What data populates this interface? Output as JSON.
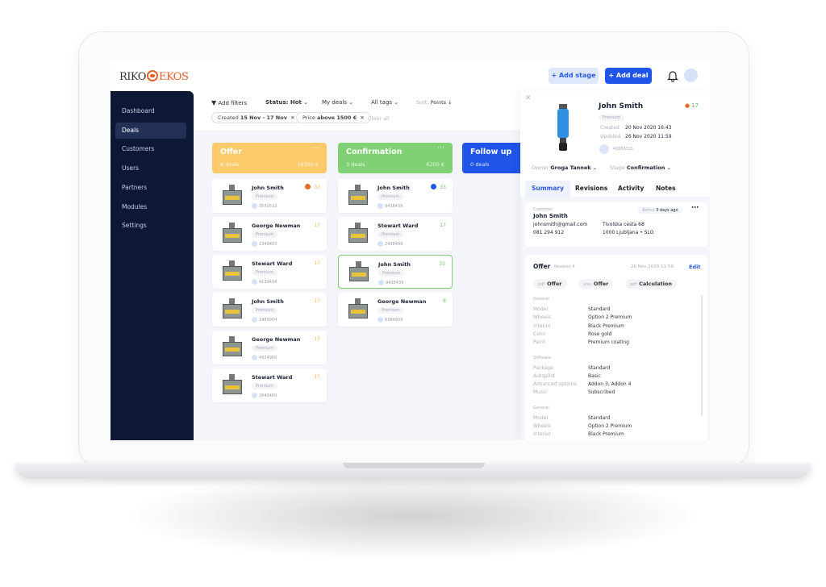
{
  "brand": {
    "logo_left": "RIKO",
    "logo_right": "EKOS"
  },
  "header": {
    "add_stage": "+ Add stage",
    "add_deal": "+ Add deal",
    "icons": [
      "bell-icon",
      "avatar"
    ]
  },
  "sidebar": {
    "items": [
      {
        "label": "Dashboard"
      },
      {
        "label": "Deals",
        "active": true
      },
      {
        "label": "Customers"
      },
      {
        "label": "Users"
      },
      {
        "label": "Partners"
      },
      {
        "label": "Modules"
      },
      {
        "label": "Settings"
      }
    ]
  },
  "filters": {
    "add_filters": "Add filters",
    "status": "Status: Hot",
    "my_deals": "My deals",
    "all_tags": "All tags",
    "sort_label": "Sort:",
    "sort_value": "Points ↓",
    "chips": [
      {
        "prefix": "Created",
        "value": "15 Nov - 17 Nov"
      },
      {
        "prefix": "Price",
        "value": "above 1500 €"
      }
    ],
    "clear_all": "Clear all"
  },
  "columns": [
    {
      "title": "Offer",
      "count": "6 deals",
      "total": "18300 €",
      "color": "#fbcb6b",
      "score_color": "#f5b94a",
      "cards": [
        {
          "name": "John Smith",
          "tag": "Premium",
          "id": "3532532",
          "score": "33",
          "badge": "fire"
        },
        {
          "name": "George Newman",
          "tag": "Premium",
          "id": "1349483",
          "score": "17"
        },
        {
          "name": "Stewart Ward",
          "tag": "Premium",
          "id": "4139434",
          "score": "17"
        },
        {
          "name": "John Smith",
          "tag": "Premium",
          "id": "3483904",
          "score": "17"
        },
        {
          "name": "George Newman",
          "tag": "Premium",
          "id": "4924900",
          "score": "17"
        },
        {
          "name": "Stewart Ward",
          "tag": "Premium",
          "id": "2849400",
          "score": "17"
        }
      ]
    },
    {
      "title": "Confirmation",
      "count": "3 deals",
      "total": "6200 €",
      "color": "#7fd174",
      "score_color": "#6cc263",
      "cards": [
        {
          "name": "John Smith",
          "tag": "Premium",
          "id": "9438439",
          "score": "33",
          "badge": "blue"
        },
        {
          "name": "Stewart Ward",
          "tag": "Premium",
          "id": "2438499",
          "score": "17"
        },
        {
          "name": "John Smith",
          "tag": "Premium",
          "id": "9438439",
          "score": "33",
          "selected": true
        },
        {
          "name": "George Newman",
          "tag": "Premium",
          "id": "8384939",
          "score": "8"
        }
      ]
    },
    {
      "title": "Follow up",
      "count": "0 deals",
      "total": "",
      "color": "#1f55e8",
      "cards": []
    }
  ],
  "detail": {
    "name": "John Smith",
    "tag": "Premium",
    "score": "17",
    "created_label": "Created",
    "created": "20 Nov 2020   16:43",
    "updated_label": "Updated",
    "updated": "26 Nov 2020   11:59",
    "id": "43956321",
    "owner_label": "Owner",
    "owner": "Groga Tannek",
    "stage_label": "Stage",
    "stage": "Confirmation",
    "tabs": [
      "Summary",
      "Revisions",
      "Activity",
      "Notes"
    ],
    "customer": {
      "label": "Customer",
      "name": "John Smith",
      "email": "johnsmith@gmail.com",
      "phone": "081 294 912",
      "address1": "Tivolska cesta 68",
      "address2": "1000 Ljubljana • SLO",
      "status": "Active",
      "status_time": "3 days ago"
    },
    "offer": {
      "title": "Offer",
      "revision": "Revision 4",
      "date": "26 Nov 2020   11:59",
      "edit": "Edit",
      "docs": [
        {
          "type": "pdf",
          "name": "Offer"
        },
        {
          "type": "xlsx",
          "name": "Offer"
        },
        {
          "type": "pdf",
          "name": "Calculation"
        }
      ],
      "sections": [
        {
          "title": "General",
          "rows": [
            [
              "Model",
              "Standard"
            ],
            [
              "Wheels",
              "Option 2 Premium"
            ],
            [
              "Interior",
              "Black Premium"
            ],
            [
              "Color",
              "Rose gold"
            ],
            [
              "Paint",
              "Premium coating"
            ]
          ]
        },
        {
          "title": "Software",
          "rows": [
            [
              "Package",
              "Standard"
            ],
            [
              "Autopilot",
              "Basic"
            ],
            [
              "Advanced options",
              "Addon 3, Addon 4"
            ],
            [
              "Music",
              "Subscribed"
            ]
          ]
        },
        {
          "title": "General",
          "rows": [
            [
              "Model",
              "Standard"
            ],
            [
              "Wheels",
              "Option 2 Premium"
            ],
            [
              "Interior",
              "Black Premium"
            ]
          ]
        }
      ]
    }
  }
}
